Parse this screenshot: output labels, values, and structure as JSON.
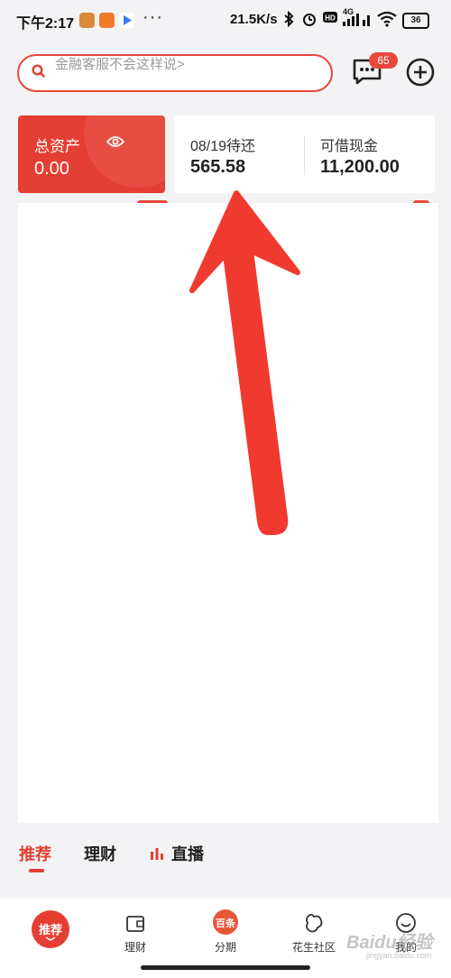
{
  "status_bar": {
    "time": "下午2:17",
    "dots": "···",
    "network_speed": "21.5K/s",
    "battery": "36",
    "signal_label": "4G"
  },
  "header": {
    "search_placeholder": "金融客服不会这样说>",
    "message_badge": "65"
  },
  "summary": {
    "assets_label": "总资产",
    "assets_value": "0.00",
    "due_label": "08/19待还",
    "due_value": "565.58",
    "cash_label": "可借现金",
    "cash_value": "11,200.00"
  },
  "feed_tabs": {
    "recommend": "推荐",
    "finance": "理财",
    "live": "直播"
  },
  "bottom_nav": {
    "home": "推荐",
    "finance": "理财",
    "installment_badge": "百条",
    "installment": "分期",
    "community": "花生社区",
    "mine": "我的"
  },
  "watermark": {
    "brand": "Baidu经验",
    "url": "jingyan.baidu.com"
  },
  "colors": {
    "accent": "#e53e32",
    "arrow": "#f03a2f",
    "background": "#f3f3f5"
  }
}
